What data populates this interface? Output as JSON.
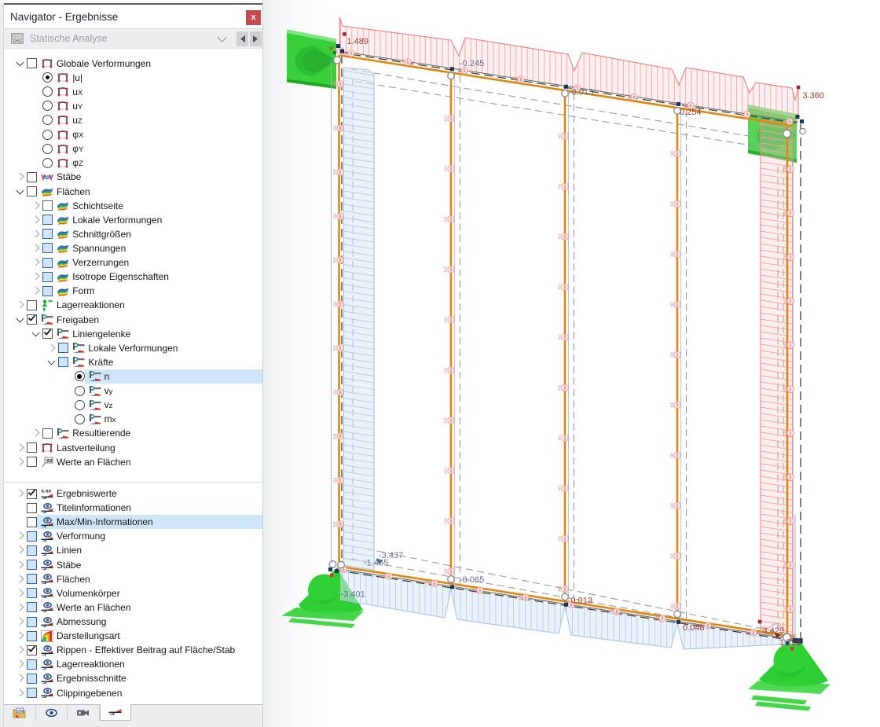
{
  "window": {
    "title": "Navigator - Ergebnisse",
    "close_label": "x"
  },
  "toolbar": {
    "analysis_selector": "Statische Analyse"
  },
  "results_tree": {
    "items": [
      {
        "label": "Globale Verformungen",
        "sub": "",
        "level": 0,
        "expander": "open",
        "control": "cb",
        "state": "unchecked",
        "icon": "frame-icon",
        "highlighted": false
      },
      {
        "label": "|u|",
        "sub": "",
        "level": 1,
        "expander": "none",
        "control": "radio",
        "state": "on",
        "icon": "frame-icon",
        "highlighted": false
      },
      {
        "label": "u",
        "sub": "X",
        "level": 1,
        "expander": "none",
        "control": "radio",
        "state": "off",
        "icon": "frame-icon",
        "highlighted": false
      },
      {
        "label": "u",
        "sub": "Y",
        "level": 1,
        "expander": "none",
        "control": "radio",
        "state": "off",
        "icon": "frame-icon",
        "highlighted": false
      },
      {
        "label": "u",
        "sub": "Z",
        "level": 1,
        "expander": "none",
        "control": "radio",
        "state": "off",
        "icon": "frame-icon",
        "highlighted": false
      },
      {
        "label": "φ",
        "sub": "X",
        "level": 1,
        "expander": "none",
        "control": "radio",
        "state": "off",
        "icon": "frame-icon",
        "highlighted": false
      },
      {
        "label": "φ",
        "sub": "Y",
        "level": 1,
        "expander": "none",
        "control": "radio",
        "state": "off",
        "icon": "frame-icon",
        "highlighted": false
      },
      {
        "label": "φ",
        "sub": "Z",
        "level": 1,
        "expander": "none",
        "control": "radio",
        "state": "off",
        "icon": "frame-icon",
        "highlighted": false
      },
      {
        "label": "Stäbe",
        "sub": "",
        "level": 0,
        "expander": "closed",
        "control": "cb",
        "state": "unchecked",
        "icon": "beam-icon",
        "highlighted": false
      },
      {
        "label": "Flächen",
        "sub": "",
        "level": 0,
        "expander": "open",
        "control": "cb",
        "state": "unchecked",
        "icon": "surface-icon",
        "highlighted": false
      },
      {
        "label": "Schichtseite",
        "sub": "",
        "level": 1,
        "expander": "closed",
        "control": "cb",
        "state": "unchecked",
        "icon": "surface-icon",
        "highlighted": false
      },
      {
        "label": "Lokale Verformungen",
        "sub": "",
        "level": 1,
        "expander": "closed",
        "control": "cb",
        "state": "partial",
        "icon": "surface-icon",
        "highlighted": false
      },
      {
        "label": "Schnittgrößen",
        "sub": "",
        "level": 1,
        "expander": "closed",
        "control": "cb",
        "state": "partial",
        "icon": "surface-icon",
        "highlighted": false
      },
      {
        "label": "Spannungen",
        "sub": "",
        "level": 1,
        "expander": "closed",
        "control": "cb",
        "state": "partial",
        "icon": "surface-icon",
        "highlighted": false
      },
      {
        "label": "Verzerrungen",
        "sub": "",
        "level": 1,
        "expander": "closed",
        "control": "cb",
        "state": "partial",
        "icon": "surface-icon",
        "highlighted": false
      },
      {
        "label": "Isotrope Eigenschaften",
        "sub": "",
        "level": 1,
        "expander": "closed",
        "control": "cb",
        "state": "partial",
        "icon": "surface-icon",
        "highlighted": false
      },
      {
        "label": "Form",
        "sub": "",
        "level": 1,
        "expander": "closed",
        "control": "cb",
        "state": "partial",
        "icon": "surface-icon",
        "highlighted": false
      },
      {
        "label": "Lagerreaktionen",
        "sub": "",
        "level": 0,
        "expander": "closed",
        "control": "cb",
        "state": "unchecked",
        "icon": "support-icon",
        "highlighted": false
      },
      {
        "label": "Freigaben",
        "sub": "",
        "level": 0,
        "expander": "open",
        "control": "cb",
        "state": "checked",
        "icon": "hinge-icon",
        "highlighted": false
      },
      {
        "label": "Liniengelenke",
        "sub": "",
        "level": 1,
        "expander": "open",
        "control": "cb",
        "state": "checked",
        "icon": "hinge-icon",
        "highlighted": false
      },
      {
        "label": "Lokale Verformungen",
        "sub": "",
        "level": 2,
        "expander": "closed",
        "control": "cb",
        "state": "partial",
        "icon": "hinge-icon",
        "highlighted": false
      },
      {
        "label": "Kräfte",
        "sub": "",
        "level": 2,
        "expander": "open",
        "control": "cb",
        "state": "partial",
        "icon": "hinge-icon",
        "highlighted": false
      },
      {
        "label": "n",
        "sub": "",
        "level": 3,
        "expander": "none",
        "control": "radio",
        "state": "on",
        "icon": "hinge-icon",
        "highlighted": true
      },
      {
        "label": "v",
        "sub": "y",
        "level": 3,
        "expander": "none",
        "control": "radio",
        "state": "off",
        "icon": "hinge-icon",
        "highlighted": false
      },
      {
        "label": "v",
        "sub": "z",
        "level": 3,
        "expander": "none",
        "control": "radio",
        "state": "off",
        "icon": "hinge-icon",
        "highlighted": false
      },
      {
        "label": "m",
        "sub": "x",
        "level": 3,
        "expander": "none",
        "control": "radio",
        "state": "off",
        "icon": "hinge-icon",
        "highlighted": false
      },
      {
        "label": "Resultierende",
        "sub": "",
        "level": 1,
        "expander": "closed",
        "control": "cb",
        "state": "unchecked",
        "icon": "hinge-icon",
        "highlighted": false
      },
      {
        "label": "Lastverteilung",
        "sub": "",
        "level": 0,
        "expander": "closed",
        "control": "cb",
        "state": "unchecked",
        "icon": "frame-icon",
        "highlighted": false
      },
      {
        "label": "Werte an Flächen",
        "sub": "",
        "level": 0,
        "expander": "closed",
        "control": "cb",
        "state": "unchecked",
        "icon": "flag-icon",
        "highlighted": false
      }
    ]
  },
  "display_tree": {
    "items": [
      {
        "label": "Ergebniswerte",
        "sub": "",
        "level": 0,
        "expander": "closed",
        "control": "cb",
        "state": "checked",
        "icon": "xvals-icon",
        "highlighted": false
      },
      {
        "label": "Titelinformationen",
        "sub": "",
        "level": 0,
        "expander": "none",
        "control": "cb",
        "state": "unchecked",
        "icon": "eye-icon",
        "highlighted": false
      },
      {
        "label": "Max/Min-Informationen",
        "sub": "",
        "level": 0,
        "expander": "none",
        "control": "cb",
        "state": "unchecked",
        "icon": "eye-icon",
        "highlighted": true
      },
      {
        "label": "Verformung",
        "sub": "",
        "level": 0,
        "expander": "closed",
        "control": "cb",
        "state": "partial",
        "icon": "eye-icon",
        "highlighted": false
      },
      {
        "label": "Linien",
        "sub": "",
        "level": 0,
        "expander": "closed",
        "control": "cb",
        "state": "partial",
        "icon": "eye-icon",
        "highlighted": false
      },
      {
        "label": "Stäbe",
        "sub": "",
        "level": 0,
        "expander": "closed",
        "control": "cb",
        "state": "partial",
        "icon": "eye-icon",
        "highlighted": false
      },
      {
        "label": "Flächen",
        "sub": "",
        "level": 0,
        "expander": "closed",
        "control": "cb",
        "state": "partial",
        "icon": "eye-icon",
        "highlighted": false
      },
      {
        "label": "Volumenkörper",
        "sub": "",
        "level": 0,
        "expander": "closed",
        "control": "cb",
        "state": "partial",
        "icon": "eye-icon",
        "highlighted": false
      },
      {
        "label": "Werte an Flächen",
        "sub": "",
        "level": 0,
        "expander": "closed",
        "control": "cb",
        "state": "partial",
        "icon": "eye-icon",
        "highlighted": false
      },
      {
        "label": "Abmessung",
        "sub": "",
        "level": 0,
        "expander": "closed",
        "control": "cb",
        "state": "partial",
        "icon": "eye-icon",
        "highlighted": false
      },
      {
        "label": "Darstellungsart",
        "sub": "",
        "level": 0,
        "expander": "closed",
        "control": "cb",
        "state": "partial",
        "icon": "rainbow-icon",
        "highlighted": false
      },
      {
        "label": "Rippen - Effektiver Beitrag auf Fläche/Stab",
        "sub": "",
        "level": 0,
        "expander": "closed",
        "control": "cb",
        "state": "checked",
        "icon": "eye-icon",
        "highlighted": false
      },
      {
        "label": "Lagerreaktionen",
        "sub": "",
        "level": 0,
        "expander": "closed",
        "control": "cb",
        "state": "partial",
        "icon": "eye-icon",
        "highlighted": false
      },
      {
        "label": "Ergebnisschnitte",
        "sub": "",
        "level": 0,
        "expander": "closed",
        "control": "cb",
        "state": "partial",
        "icon": "eye-icon",
        "highlighted": false
      },
      {
        "label": "Clippingebenen",
        "sub": "",
        "level": 0,
        "expander": "closed",
        "control": "cb",
        "state": "partial",
        "icon": "eye-icon",
        "highlighted": false
      }
    ]
  },
  "bottom_tabs": {
    "active_index": 3,
    "items": [
      {
        "name": "data-panel",
        "icon": "folder-results-icon"
      },
      {
        "name": "display-panel",
        "icon": "eye-icon"
      },
      {
        "name": "views-panel",
        "icon": "camera-icon"
      },
      {
        "name": "results-panel",
        "icon": "result-diagram-icon"
      }
    ]
  },
  "canvas": {
    "values": [
      {
        "text": "1.489",
        "sign": "pos"
      },
      {
        "text": "-0.245",
        "sign": "neg"
      },
      {
        "text": "-0.013",
        "sign": "neg"
      },
      {
        "text": "0.254",
        "sign": "pos"
      },
      {
        "text": "3.360",
        "sign": "pos"
      },
      {
        "text": "-3.437",
        "sign": "neg"
      },
      {
        "text": "-1.455",
        "sign": "neg"
      },
      {
        "text": "-3.401",
        "sign": "neg"
      },
      {
        "text": "-0.065",
        "sign": "neg"
      },
      {
        "text": "0.013",
        "sign": "pos"
      },
      {
        "text": "0.048",
        "sign": "pos"
      },
      {
        "text": "3.429",
        "sign": "pos"
      },
      {
        "text": "1.752",
        "sign": "pos"
      }
    ]
  }
}
